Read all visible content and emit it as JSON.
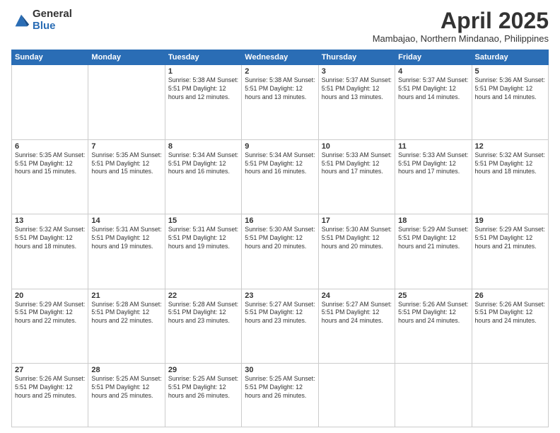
{
  "logo": {
    "general": "General",
    "blue": "Blue"
  },
  "title": {
    "month": "April 2025",
    "location": "Mambajao, Northern Mindanao, Philippines"
  },
  "days_header": [
    "Sunday",
    "Monday",
    "Tuesday",
    "Wednesday",
    "Thursday",
    "Friday",
    "Saturday"
  ],
  "weeks": [
    [
      {
        "day": "",
        "info": ""
      },
      {
        "day": "",
        "info": ""
      },
      {
        "day": "1",
        "info": "Sunrise: 5:38 AM\nSunset: 5:51 PM\nDaylight: 12 hours and 12 minutes."
      },
      {
        "day": "2",
        "info": "Sunrise: 5:38 AM\nSunset: 5:51 PM\nDaylight: 12 hours and 13 minutes."
      },
      {
        "day": "3",
        "info": "Sunrise: 5:37 AM\nSunset: 5:51 PM\nDaylight: 12 hours and 13 minutes."
      },
      {
        "day": "4",
        "info": "Sunrise: 5:37 AM\nSunset: 5:51 PM\nDaylight: 12 hours and 14 minutes."
      },
      {
        "day": "5",
        "info": "Sunrise: 5:36 AM\nSunset: 5:51 PM\nDaylight: 12 hours and 14 minutes."
      }
    ],
    [
      {
        "day": "6",
        "info": "Sunrise: 5:35 AM\nSunset: 5:51 PM\nDaylight: 12 hours and 15 minutes."
      },
      {
        "day": "7",
        "info": "Sunrise: 5:35 AM\nSunset: 5:51 PM\nDaylight: 12 hours and 15 minutes."
      },
      {
        "day": "8",
        "info": "Sunrise: 5:34 AM\nSunset: 5:51 PM\nDaylight: 12 hours and 16 minutes."
      },
      {
        "day": "9",
        "info": "Sunrise: 5:34 AM\nSunset: 5:51 PM\nDaylight: 12 hours and 16 minutes."
      },
      {
        "day": "10",
        "info": "Sunrise: 5:33 AM\nSunset: 5:51 PM\nDaylight: 12 hours and 17 minutes."
      },
      {
        "day": "11",
        "info": "Sunrise: 5:33 AM\nSunset: 5:51 PM\nDaylight: 12 hours and 17 minutes."
      },
      {
        "day": "12",
        "info": "Sunrise: 5:32 AM\nSunset: 5:51 PM\nDaylight: 12 hours and 18 minutes."
      }
    ],
    [
      {
        "day": "13",
        "info": "Sunrise: 5:32 AM\nSunset: 5:51 PM\nDaylight: 12 hours and 18 minutes."
      },
      {
        "day": "14",
        "info": "Sunrise: 5:31 AM\nSunset: 5:51 PM\nDaylight: 12 hours and 19 minutes."
      },
      {
        "day": "15",
        "info": "Sunrise: 5:31 AM\nSunset: 5:51 PM\nDaylight: 12 hours and 19 minutes."
      },
      {
        "day": "16",
        "info": "Sunrise: 5:30 AM\nSunset: 5:51 PM\nDaylight: 12 hours and 20 minutes."
      },
      {
        "day": "17",
        "info": "Sunrise: 5:30 AM\nSunset: 5:51 PM\nDaylight: 12 hours and 20 minutes."
      },
      {
        "day": "18",
        "info": "Sunrise: 5:29 AM\nSunset: 5:51 PM\nDaylight: 12 hours and 21 minutes."
      },
      {
        "day": "19",
        "info": "Sunrise: 5:29 AM\nSunset: 5:51 PM\nDaylight: 12 hours and 21 minutes."
      }
    ],
    [
      {
        "day": "20",
        "info": "Sunrise: 5:29 AM\nSunset: 5:51 PM\nDaylight: 12 hours and 22 minutes."
      },
      {
        "day": "21",
        "info": "Sunrise: 5:28 AM\nSunset: 5:51 PM\nDaylight: 12 hours and 22 minutes."
      },
      {
        "day": "22",
        "info": "Sunrise: 5:28 AM\nSunset: 5:51 PM\nDaylight: 12 hours and 23 minutes."
      },
      {
        "day": "23",
        "info": "Sunrise: 5:27 AM\nSunset: 5:51 PM\nDaylight: 12 hours and 23 minutes."
      },
      {
        "day": "24",
        "info": "Sunrise: 5:27 AM\nSunset: 5:51 PM\nDaylight: 12 hours and 24 minutes."
      },
      {
        "day": "25",
        "info": "Sunrise: 5:26 AM\nSunset: 5:51 PM\nDaylight: 12 hours and 24 minutes."
      },
      {
        "day": "26",
        "info": "Sunrise: 5:26 AM\nSunset: 5:51 PM\nDaylight: 12 hours and 24 minutes."
      }
    ],
    [
      {
        "day": "27",
        "info": "Sunrise: 5:26 AM\nSunset: 5:51 PM\nDaylight: 12 hours and 25 minutes."
      },
      {
        "day": "28",
        "info": "Sunrise: 5:25 AM\nSunset: 5:51 PM\nDaylight: 12 hours and 25 minutes."
      },
      {
        "day": "29",
        "info": "Sunrise: 5:25 AM\nSunset: 5:51 PM\nDaylight: 12 hours and 26 minutes."
      },
      {
        "day": "30",
        "info": "Sunrise: 5:25 AM\nSunset: 5:51 PM\nDaylight: 12 hours and 26 minutes."
      },
      {
        "day": "",
        "info": ""
      },
      {
        "day": "",
        "info": ""
      },
      {
        "day": "",
        "info": ""
      }
    ]
  ]
}
